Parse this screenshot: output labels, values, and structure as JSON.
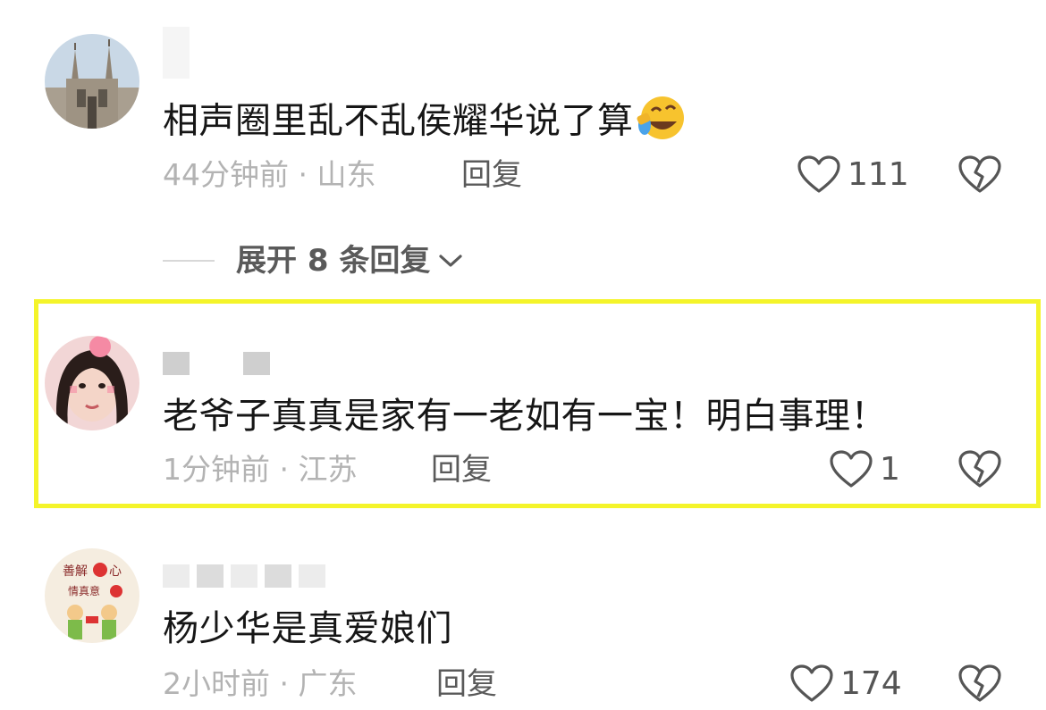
{
  "comments": [
    {
      "text": "相声圈里乱不乱侯耀华说了算",
      "emoji": "laughing-crying-emoji",
      "time": "44分钟前",
      "location": "山东",
      "meta": "44分钟前 · 山东",
      "reply_label": "回复",
      "likes": "111"
    },
    {
      "text": "老爷子真真是家有一老如有一宝！明白事理！",
      "time": "1分钟前",
      "location": "江苏",
      "meta": "1分钟前 · 江苏",
      "reply_label": "回复",
      "likes": "1",
      "highlighted": true
    },
    {
      "text": "杨少华是真爱娘们",
      "time": "2小时前",
      "location": "广东",
      "meta": "2小时前 · 广东",
      "reply_label": "回复",
      "likes": "174"
    }
  ],
  "expand_replies": {
    "label": "展开 8 条回复"
  },
  "colors": {
    "highlight_border": "#f4f42a",
    "meta_text": "#b3b3b3",
    "reply_text": "#5a5a5a"
  },
  "icons": {
    "like": "heart-outline-icon",
    "dislike": "broken-heart-icon",
    "expand": "chevron-down-icon"
  }
}
